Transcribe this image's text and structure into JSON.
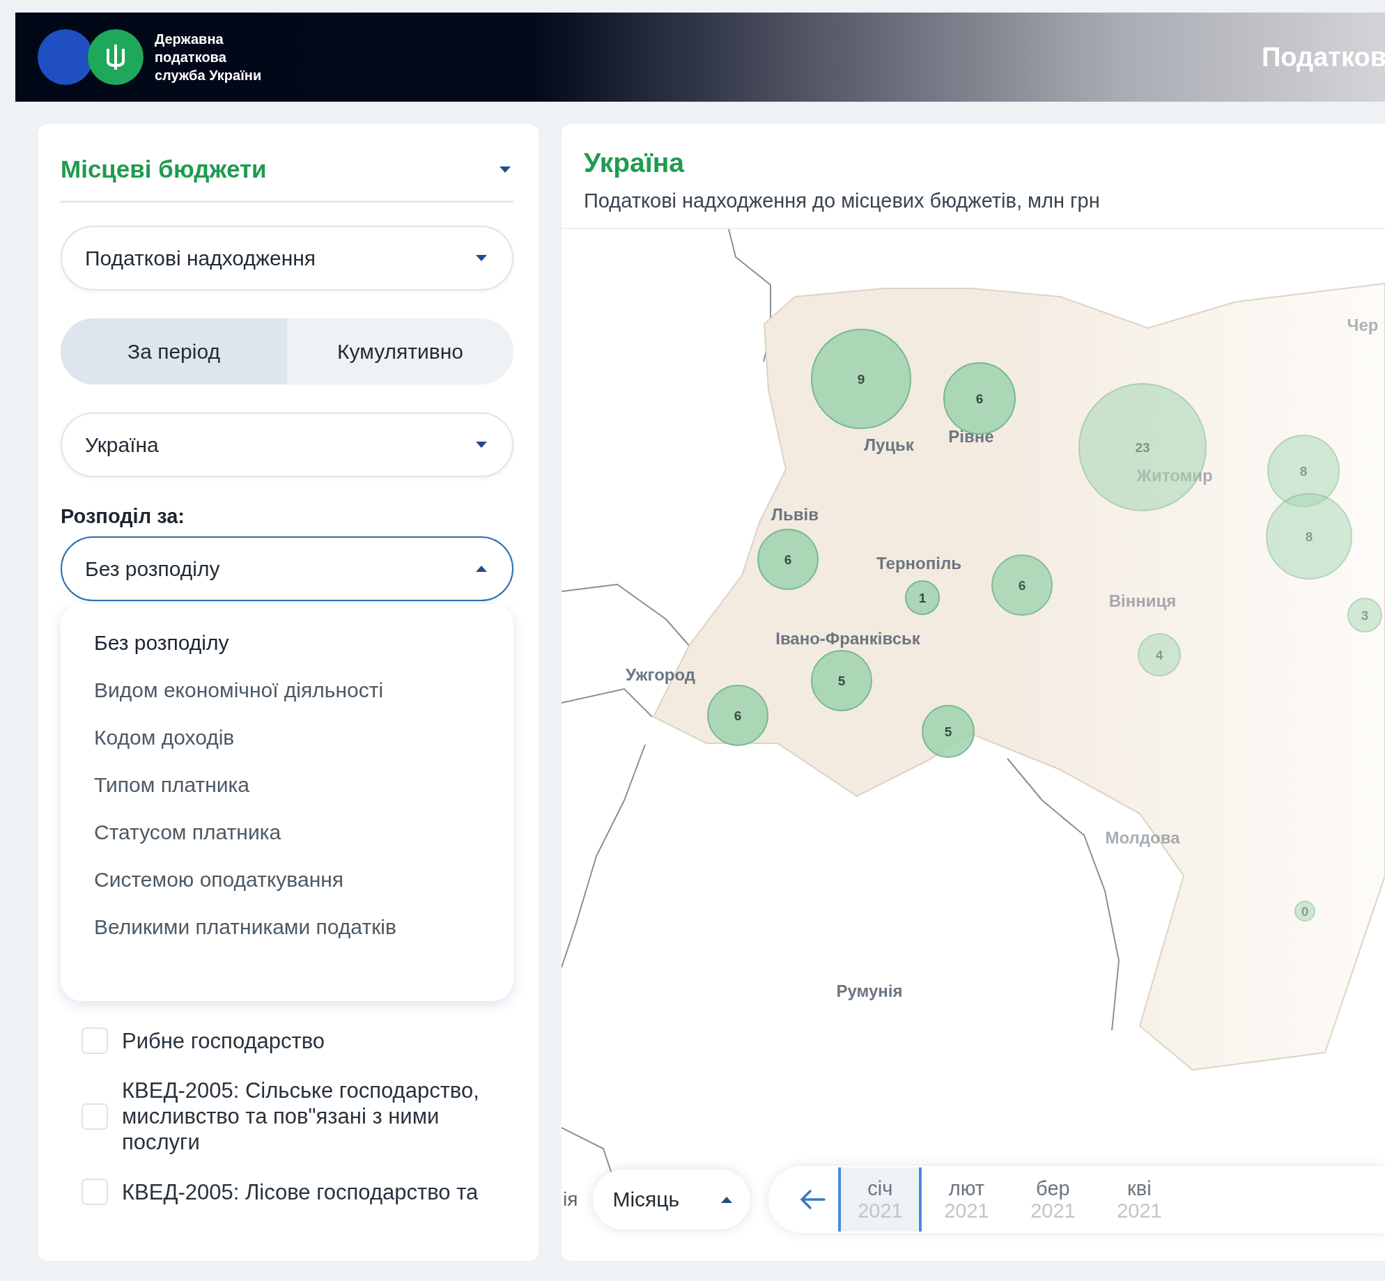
{
  "header": {
    "logo_lines": [
      "Державна",
      "податкова",
      "служба України"
    ],
    "title": "Податков"
  },
  "sidebar": {
    "section": {
      "label": "Місцеві бюджети",
      "expanded": false
    },
    "indicator_select": {
      "value": "Податкові надходження",
      "expanded": false
    },
    "mode_toggle": [
      {
        "label": "За період",
        "selected": true
      },
      {
        "label": "Кумулятивно",
        "selected": false
      }
    ],
    "region_select": {
      "value": "Україна",
      "expanded": false
    },
    "breakdown": {
      "label": "Розподіл за:",
      "value": "Без розподілу",
      "expanded": true,
      "options": [
        {
          "label": "Без розподілу",
          "selected": true
        },
        {
          "label": "Видом економічної діяльності",
          "selected": false
        },
        {
          "label": "Кодом доходів",
          "selected": false
        },
        {
          "label": "Типом платника",
          "selected": false
        },
        {
          "label": "Статусом платника",
          "selected": false
        },
        {
          "label": "Системою оподаткування",
          "selected": false
        },
        {
          "label": "Великими платниками податків",
          "selected": false
        }
      ]
    },
    "filters": [
      {
        "label": "Рибне господарство",
        "checked": false
      },
      {
        "label": "КВЕД-2005: Сільське господарство, мисливство та пов\"язані з ними послуги",
        "checked": false
      },
      {
        "label": "КВЕД-2005: Лісове господарство та",
        "checked": false
      }
    ]
  },
  "map_panel": {
    "title": "Україна",
    "subtitle": "Податкові надходження до місцевих бюджетів, млн грн",
    "place_labels": [
      "Луцьк",
      "Рівне",
      "Житомир",
      "Львів",
      "Тернопіль",
      "Вінниця",
      "Івано-Франківськ",
      "Ужгород",
      "Молдова",
      "Румунія",
      "Чер"
    ],
    "bubbles": [
      {
        "value": "9"
      },
      {
        "value": "6"
      },
      {
        "value": "23"
      },
      {
        "value": "8"
      },
      {
        "value": "8"
      },
      {
        "value": "6"
      },
      {
        "value": "1"
      },
      {
        "value": "6"
      },
      {
        "value": "4"
      },
      {
        "value": "5"
      },
      {
        "value": "6"
      },
      {
        "value": "5"
      },
      {
        "value": "3"
      },
      {
        "value": "0"
      }
    ],
    "timeline": {
      "cut_label": "ія",
      "period_select": {
        "value": "Місяць",
        "expanded": true
      },
      "months": [
        {
          "month": "січ",
          "year": "2021",
          "selected": true
        },
        {
          "month": "лют",
          "year": "2021",
          "selected": false
        },
        {
          "month": "бер",
          "year": "2021",
          "selected": false
        },
        {
          "month": "кві",
          "year": "2021",
          "selected": false
        }
      ]
    }
  }
}
